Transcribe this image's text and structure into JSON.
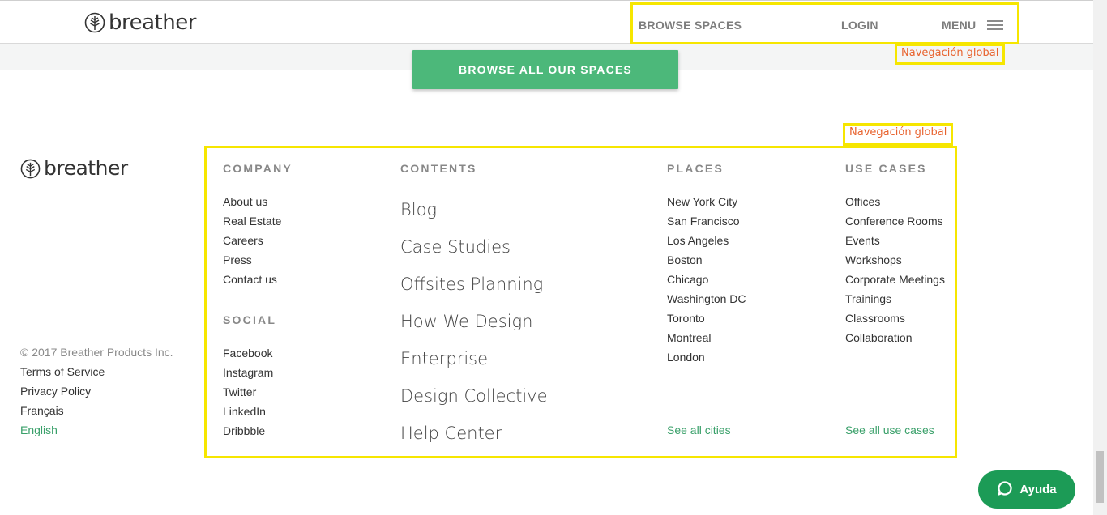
{
  "header": {
    "logo_text": "breather",
    "nav": {
      "browse_label": "BROWSE SPACES",
      "login_label": "LOGIN",
      "menu_label": "MENU"
    }
  },
  "annotations": {
    "nav_label_top": "Navegación global",
    "nav_label_footer": "Navegación global"
  },
  "cta": {
    "label": "BROWSE ALL OUR SPACES"
  },
  "footer": {
    "logo_text": "breather",
    "copyright": "© 2017 Breather Products Inc.",
    "legal_links": [
      "Terms of Service",
      "Privacy Policy",
      "Français"
    ],
    "active_language": "English",
    "company": {
      "heading": "COMPANY",
      "items": [
        "About us",
        "Real Estate",
        "Careers",
        "Press",
        "Contact us"
      ]
    },
    "social": {
      "heading": "SOCIAL",
      "items": [
        "Facebook",
        "Instagram",
        "Twitter",
        "LinkedIn",
        "Dribbble"
      ]
    },
    "contents": {
      "heading": "CONTENTS",
      "items": [
        "Blog",
        "Case Studies",
        "Offsites Planning",
        "How We Design",
        "Enterprise",
        "Design Collective",
        "Help Center"
      ]
    },
    "places": {
      "heading": "PLACES",
      "items": [
        "New York City",
        "San Francisco",
        "Los Angeles",
        "Boston",
        "Chicago",
        "Washington DC",
        "Toronto",
        "Montreal",
        "London"
      ],
      "see_all": "See all cities"
    },
    "use_cases": {
      "heading": "USE CASES",
      "items": [
        "Offices",
        "Conference Rooms",
        "Events",
        "Workshops",
        "Corporate Meetings",
        "Trainings",
        "Classrooms",
        "Collaboration"
      ],
      "see_all": "See all use cases"
    }
  },
  "help_widget": {
    "label": "Ayuda",
    "icon": "chat-bubble-icon"
  },
  "colors": {
    "brand_green": "#4cb87a",
    "link_green": "#3aa06a",
    "help_green": "#1c9b56",
    "highlight_yellow": "#f6e600",
    "annotation_orange": "#e8632f"
  }
}
